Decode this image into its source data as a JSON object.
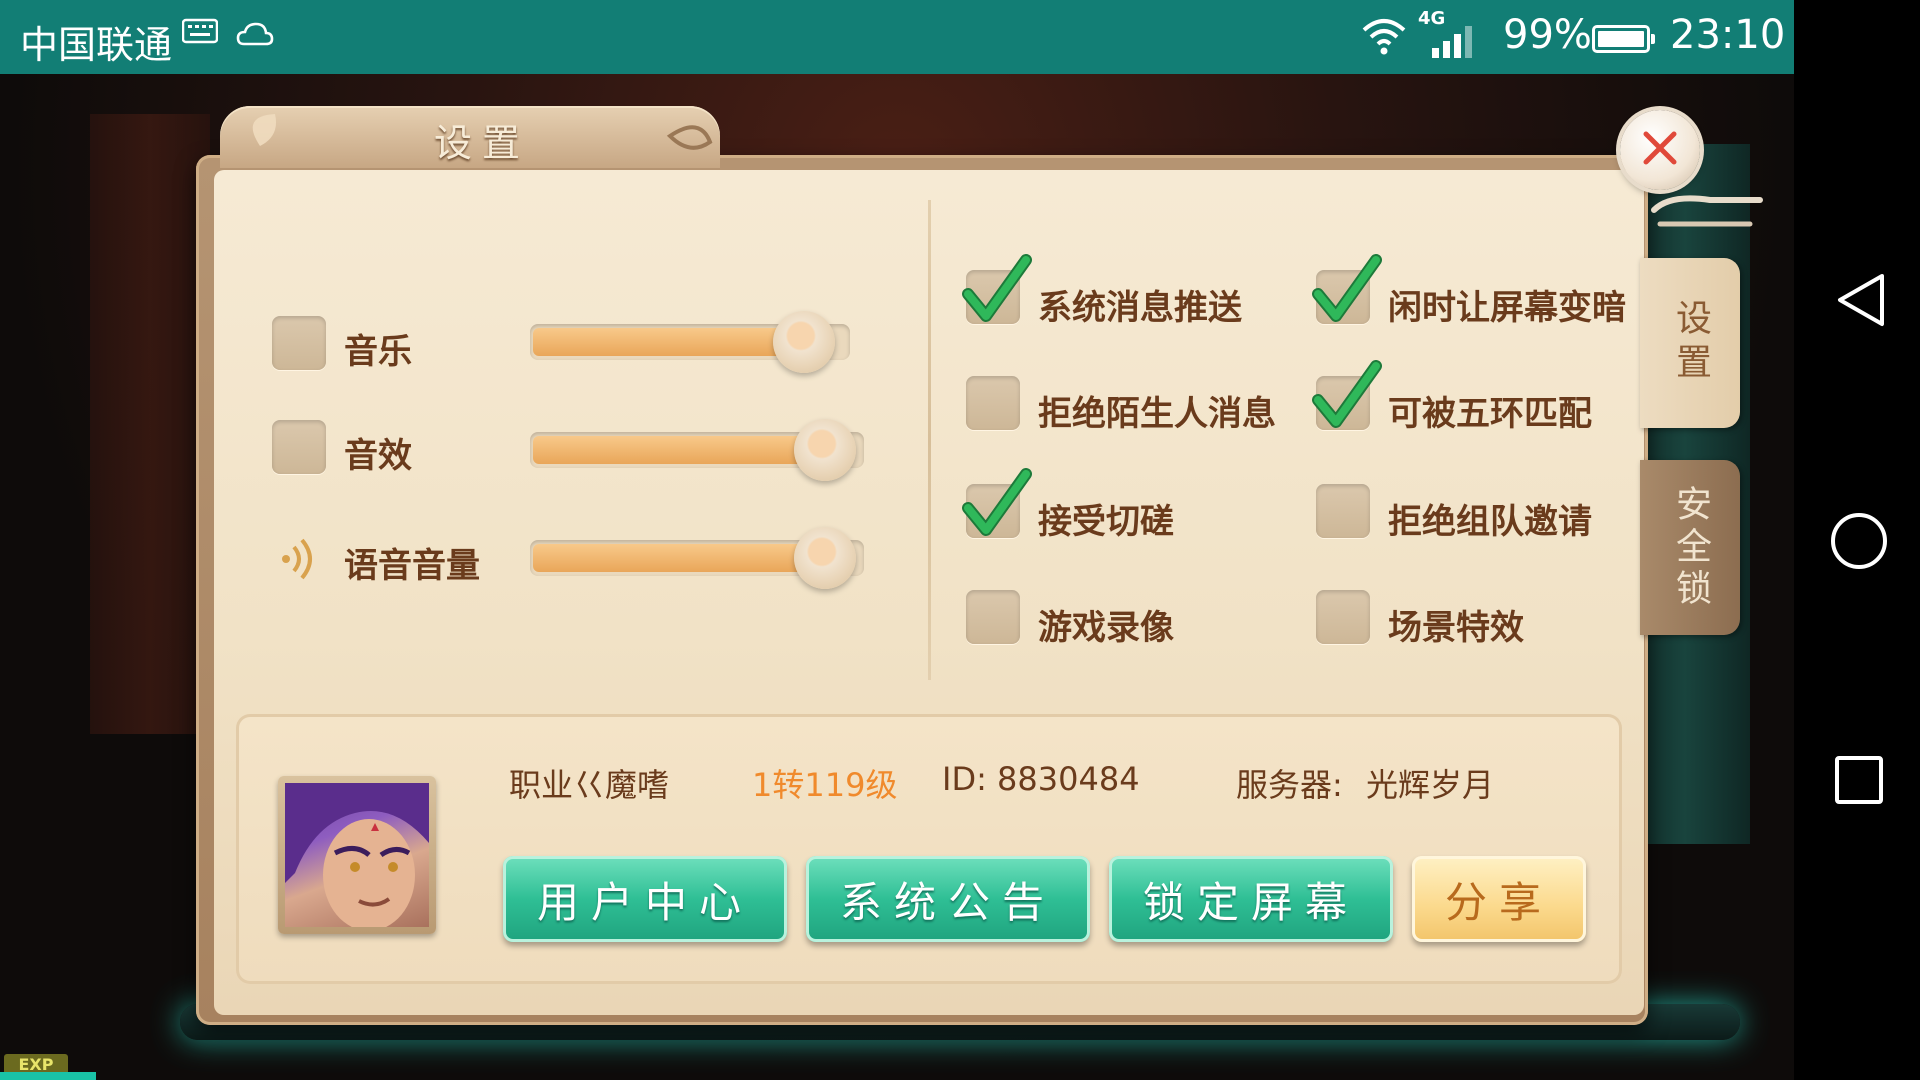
{
  "status_bar": {
    "carrier": "中国联通",
    "network": "4G",
    "battery_percent_text": "99%",
    "battery_level": 0.99,
    "time": "23:10"
  },
  "panel": {
    "title": "设置",
    "close_icon": "close-icon",
    "side_tabs": [
      {
        "label": "设置",
        "active": true
      },
      {
        "label": "安全锁",
        "active": false
      }
    ]
  },
  "audio": [
    {
      "label": "音乐",
      "checked": false,
      "level": 0.94
    },
    {
      "label": "音效",
      "checked": false,
      "level": 0.97
    },
    {
      "label": "语音音量",
      "icon": "sound-icon",
      "level": 0.97
    }
  ],
  "options": [
    {
      "label": "系统消息推送",
      "checked": true
    },
    {
      "label": "闲时让屏幕变暗",
      "checked": true
    },
    {
      "label": "拒绝陌生人消息",
      "checked": false
    },
    {
      "label": "可被五环匹配",
      "checked": true
    },
    {
      "label": "接受切磋",
      "checked": true
    },
    {
      "label": "拒绝组队邀请",
      "checked": false
    },
    {
      "label": "游戏录像",
      "checked": false
    },
    {
      "label": "场景特效",
      "checked": false
    }
  ],
  "player": {
    "profession": "职业巜魔嗜",
    "level": "1转119级",
    "id_text": "ID: 8830484",
    "server_label": "服务器:",
    "server_name": "光辉岁月"
  },
  "buttons": {
    "user_center": "用户中心",
    "announcement": "系统公告",
    "lock_screen": "锁定屏幕",
    "share": "分享"
  },
  "hud": {
    "exp_label": "EXP"
  },
  "colors": {
    "status_bar": "#127e75",
    "label_brown": "#6a3b1c",
    "level_orange": "#f08a2c",
    "check_green": "#2fb85a",
    "button_green": "#2fbf95"
  }
}
